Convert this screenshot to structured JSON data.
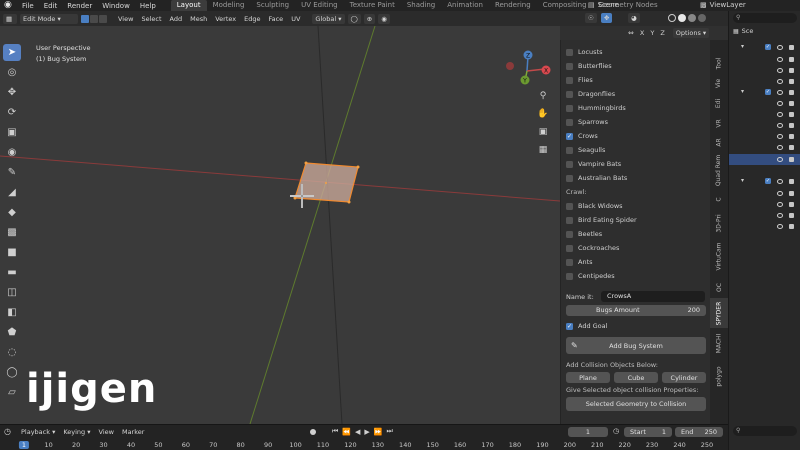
{
  "topbar": {
    "menus": [
      "File",
      "Edit",
      "Render",
      "Window",
      "Help"
    ],
    "workspaces": [
      "Layout",
      "Modeling",
      "Sculpting",
      "UV Editing",
      "Texture Paint",
      "Shading",
      "Animation",
      "Rendering",
      "Compositing",
      "Geometry Nodes"
    ],
    "active_workspace": "Layout",
    "scene_label": "Scene",
    "view_layer_label": "ViewLayer"
  },
  "viewport_header": {
    "mode": "Edit Mode",
    "menus": [
      "View",
      "Select",
      "Add",
      "Mesh",
      "Vertex",
      "Edge",
      "Face",
      "UV"
    ],
    "transform_orientation": "Global",
    "axis_x": "X",
    "axis_y": "Y",
    "axis_z": "Z",
    "options_label": "Options"
  },
  "viewport": {
    "perspective_label": "User Perspective",
    "object_label": "(1) Bug System",
    "watermark": "ijigen",
    "gizmo": {
      "x": "X",
      "y": "Y",
      "z": "Z"
    }
  },
  "npanel": {
    "fly_items": [
      {
        "label": "Locusts",
        "checked": false
      },
      {
        "label": "Butterflies",
        "checked": false
      },
      {
        "label": "Flies",
        "checked": false
      },
      {
        "label": "Dragonflies",
        "checked": false
      },
      {
        "label": "Hummingbirds",
        "checked": false
      },
      {
        "label": "Sparrows",
        "checked": false
      },
      {
        "label": "Crows",
        "checked": true
      },
      {
        "label": "Seagulls",
        "checked": false
      },
      {
        "label": "Vampire Bats",
        "checked": false
      },
      {
        "label": "Australian Bats",
        "checked": false
      }
    ],
    "crawl_label": "Crawl:",
    "crawl_items": [
      {
        "label": "Black Widows",
        "checked": false
      },
      {
        "label": "Bird Eating Spider",
        "checked": false
      },
      {
        "label": "Beetles",
        "checked": false
      },
      {
        "label": "Cockroaches",
        "checked": false
      },
      {
        "label": "Ants",
        "checked": false
      },
      {
        "label": "Centipedes",
        "checked": false
      }
    ],
    "name_label": "Name it:",
    "name_value": "CrowsA",
    "bugs_amount_label": "Bugs Amount",
    "bugs_amount_value": "200",
    "add_goal_label": "Add Goal",
    "add_bug_system_label": "Add Bug System",
    "collision_label": "Add Collision Objects Below:",
    "collision_buttons": [
      "Plane",
      "Cube",
      "Cylinder"
    ],
    "give_label": "Give Selected object collision Properties:",
    "selected_collision_label": "Selected Geometry to Collision"
  },
  "vtabs": [
    "Tool",
    "Vie",
    "Edi",
    "VR",
    "AR",
    "Quad Rem",
    "C",
    "3D-Pri",
    "VirtuCam",
    "OC",
    "SPYDER",
    "MACHI",
    "polygo"
  ],
  "vtabs_active": "SPYDER",
  "outliner": {
    "scene_label": "Sce"
  },
  "timeline": {
    "menus": [
      "Playback",
      "Keying",
      "View",
      "Marker"
    ],
    "current_frame": "1",
    "start_label": "Start",
    "start_value": "1",
    "end_label": "End",
    "end_value": "250",
    "ticks": [
      "1",
      "10",
      "20",
      "30",
      "40",
      "50",
      "60",
      "70",
      "80",
      "90",
      "100",
      "110",
      "120",
      "130",
      "140",
      "150",
      "160",
      "170",
      "180",
      "190",
      "200",
      "210",
      "220",
      "230",
      "240",
      "250"
    ]
  },
  "colors": {
    "accent": "#4a7fc2",
    "selection_face": "#c8a898",
    "selection_edge": "#f08a30",
    "axis_x": "#c24a4a",
    "axis_y": "#7fa83a"
  }
}
